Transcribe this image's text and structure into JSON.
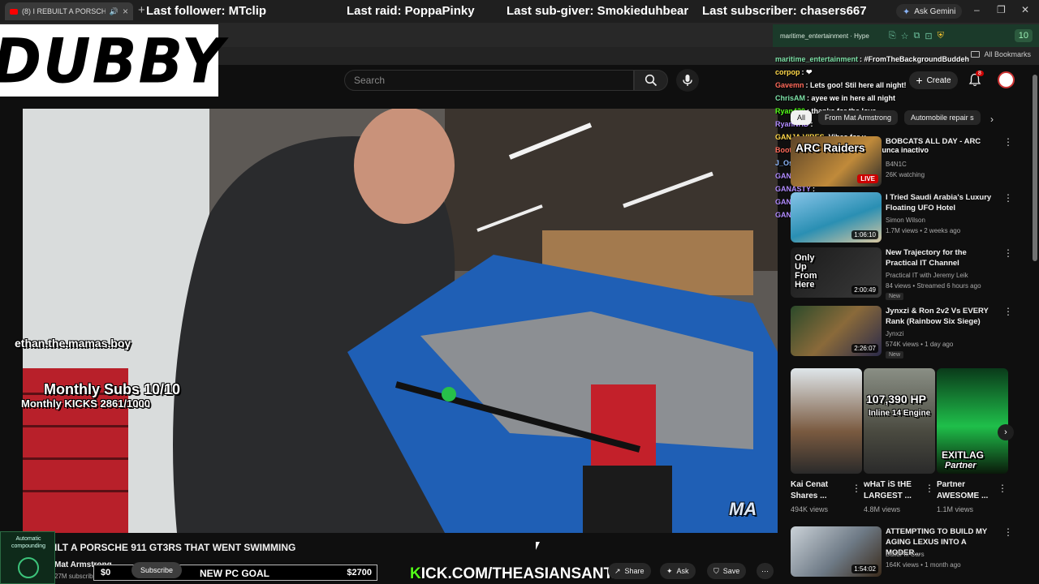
{
  "browser": {
    "tab_title": "(8) I REBUILT A PORSCHE 9",
    "new_tab": "+",
    "ask_gemini": "Ask Gemini",
    "all_bookmarks": "All Bookmarks",
    "window_controls": [
      "–",
      "❐",
      "✕"
    ]
  },
  "stream_overlay": {
    "logo": "DUBBY",
    "last_follower": "Last follower: MTclip",
    "last_raid": "Last raid: PoppaPinky",
    "last_sub_giver": "Last sub-giver: Smokieduhbear",
    "last_subscriber": "Last subscriber: chasers667",
    "viewer_name": "ethan.the.mamas.boy",
    "monthly_subs": "Monthly Subs 10/10",
    "monthly_kicks": "Monthly KICKS 2861/1000",
    "goal": {
      "current": "$0",
      "label": "NEW PC GOAL",
      "target": "$2700"
    },
    "kick_url_prefix": "K",
    "kick_url_rest": "ICK.COM/THEASIANSANTA",
    "compound_widget": "Automatic compounding",
    "video_watermark": "MA"
  },
  "chat": {
    "header": "maritime_entertainment · Hype",
    "count": "10",
    "messages": [
      {
        "user": "maritime_entertainment",
        "text": ": #FromTheBackgroundBuddeh",
        "color": "#7ee2a8"
      },
      {
        "user": "corpop",
        "text": ": ❤",
        "color": "#ffd84a"
      },
      {
        "user": "Gavemn",
        "text": ": Lets goo! Stil here all night!",
        "color": "#ff6a5a"
      },
      {
        "user": "ChrisAM",
        "text": ": ayee we in here all night",
        "color": "#7ee2a8"
      },
      {
        "user": "Ryan420",
        "text": ": thanks for the love",
        "color": "#53fc18"
      },
      {
        "user": "RyanNHD",
        "text": ":",
        "color": "#b28cff"
      },
      {
        "user": "GANJA VIBES",
        "text": "-Vibes for u",
        "color": "#ffd84a"
      },
      {
        "user": "BootsitoLex",
        "text": "- Siempre activo nunca inactivo",
        "color": "#ff6a5a"
      },
      {
        "user": "J_Ose",
        "text": ": lurk",
        "color": "#8ab4f8"
      },
      {
        "user": "GANASTY",
        "text": ":",
        "color": "#b28cff"
      },
      {
        "user": "GANASTY",
        "text": ":",
        "color": "#b28cff"
      },
      {
        "user": "GANASTY",
        "text": ":",
        "color": "#b28cff"
      },
      {
        "user": "GANASTY",
        "text": ":",
        "color": "#b28cff"
      }
    ]
  },
  "youtube": {
    "search_placeholder": "Search",
    "create": "Create",
    "notifications": "8",
    "chips": [
      "All",
      "From Mat Armstrong",
      "Automobile repair s"
    ],
    "recommendations": [
      {
        "title": "BOBCATS ALL DAY - ARC",
        "channel": "B4N1C",
        "meta": "26K watching",
        "badge": "LIVE",
        "new": ""
      },
      {
        "title": "I Tried Saudi Arabia's Luxury Floating UFO Hotel",
        "channel": "Simon Wilson",
        "meta": "1.7M views • 2 weeks ago",
        "badge": "1:06:10",
        "new": ""
      },
      {
        "title": "New Trajectory for the Practical IT Channel",
        "channel": "Practical IT with Jeremy Leik",
        "meta": "84 views • Streamed 6 hours ago",
        "badge": "2:00:49",
        "new": "New"
      },
      {
        "title": "Jynxzi & Ron 2v2 Vs EVERY Rank (Rainbow Six Siege)",
        "channel": "Jynxzi",
        "meta": "574K views • 1 day ago",
        "badge": "2:26:07",
        "new": "New"
      },
      {
        "title": "ATTEMPTING TO BUILD MY AGING LEXUS INTO A MODER...",
        "channel": "BuildFix Cars",
        "meta": "164K views • 1 month ago",
        "badge": "1:54:02",
        "new": ""
      }
    ],
    "thumb_text": {
      "arc": "ARC Raiders",
      "practical_it": "Only Up From Here",
      "hp": "107,390 HP",
      "engine": "Inline 14 Engine",
      "exitlag": "EXITLAG",
      "partner": "Partner"
    },
    "shorts": [
      {
        "title": "Kai Cenat Shares ...",
        "views": "494K views"
      },
      {
        "title": "wHaT iS tHE LARGEST ...",
        "views": "4.8M views"
      },
      {
        "title": "Partner AWESOME ...",
        "views": "1.1M views"
      }
    ],
    "video": {
      "title": "ILT A PORSCHE 911 GT3RS THAT WENT SWIMMING",
      "channel": "Mat Armstrong",
      "subs": "27M subscrib",
      "subscribe": "Subscribe",
      "share": "Share",
      "ask": "Ask",
      "save": "Save",
      "more": "⋯"
    }
  }
}
